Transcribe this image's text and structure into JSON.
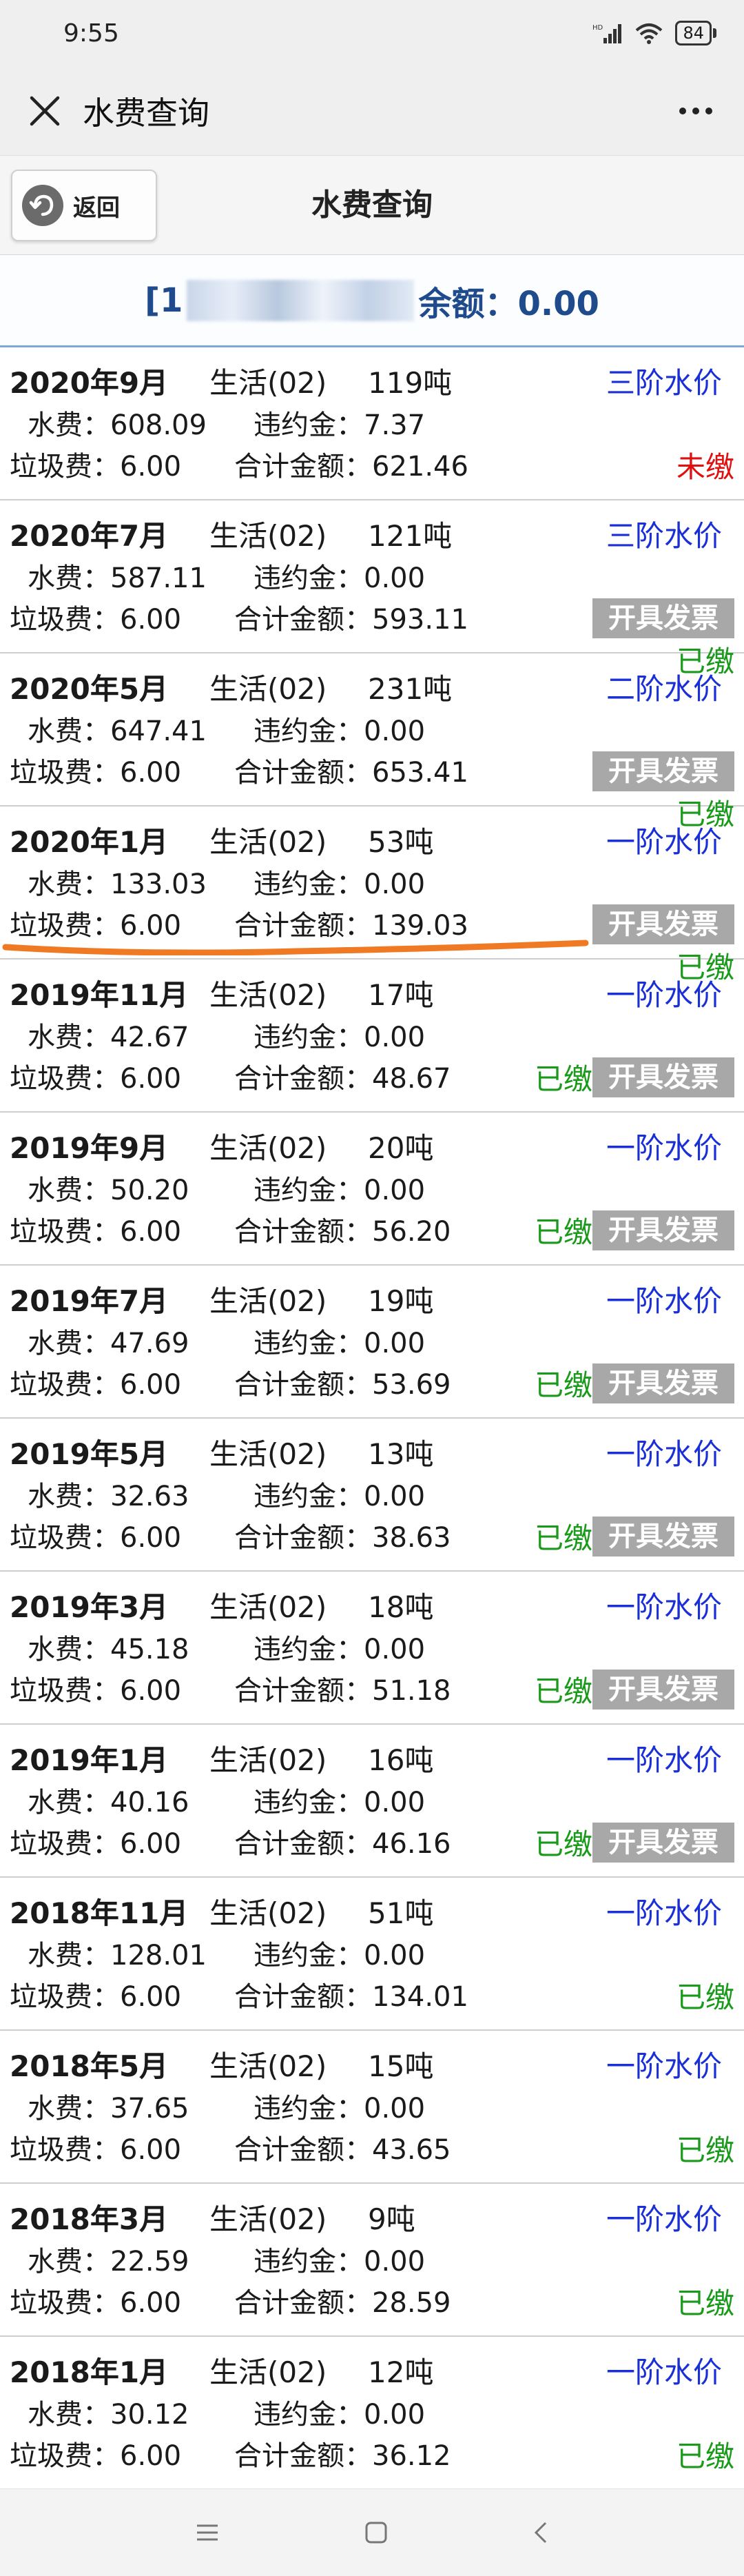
{
  "status_bar": {
    "time": "9:55",
    "battery": "84"
  },
  "title_bar": {
    "title": "水费查询"
  },
  "nav": {
    "back_label": "返回",
    "page_title": "水费查询"
  },
  "account": {
    "prefix": "[1",
    "balance_label": "余额：0.00"
  },
  "records": [
    {
      "year_month": "2020年9月",
      "usage": "生活(02)",
      "tons": "119吨",
      "tier": "三阶水价",
      "water_fee": "水费：608.09",
      "penalty": "违约金：7.37",
      "garbage_fee": "垃圾费：6.00",
      "total": "合计金额：621.46",
      "status": "未缴",
      "invoice": ""
    },
    {
      "year_month": "2020年7月",
      "usage": "生活(02)",
      "tons": "121吨",
      "tier": "三阶水价",
      "water_fee": "水费：587.11",
      "penalty": "违约金：0.00",
      "garbage_fee": "垃圾费：6.00",
      "total": "合计金额：593.11",
      "status": "已缴",
      "invoice": "开具发票"
    },
    {
      "year_month": "2020年5月",
      "usage": "生活(02)",
      "tons": "231吨",
      "tier": "二阶水价",
      "water_fee": "水费：647.41",
      "penalty": "违约金：0.00",
      "garbage_fee": "垃圾费：6.00",
      "total": "合计金额：653.41",
      "status": "已缴",
      "invoice": "开具发票"
    },
    {
      "year_month": "2020年1月",
      "usage": "生活(02)",
      "tons": "53吨",
      "tier": "一阶水价",
      "water_fee": "水费：133.03",
      "penalty": "违约金：0.00",
      "garbage_fee": "垃圾费：6.00",
      "total": "合计金额：139.03",
      "status": "已缴",
      "invoice": "开具发票"
    },
    {
      "year_month": "2019年11月",
      "usage": "生活(02)",
      "tons": "17吨",
      "tier": "一阶水价",
      "water_fee": "水费：42.67",
      "penalty": "违约金：0.00",
      "garbage_fee": "垃圾费：6.00",
      "total": "合计金额：48.67",
      "status": "已缴",
      "invoice": "开具发票"
    },
    {
      "year_month": "2019年9月",
      "usage": "生活(02)",
      "tons": "20吨",
      "tier": "一阶水价",
      "water_fee": "水费：50.20",
      "penalty": "违约金：0.00",
      "garbage_fee": "垃圾费：6.00",
      "total": "合计金额：56.20",
      "status": "已缴",
      "invoice": "开具发票"
    },
    {
      "year_month": "2019年7月",
      "usage": "生活(02)",
      "tons": "19吨",
      "tier": "一阶水价",
      "water_fee": "水费：47.69",
      "penalty": "违约金：0.00",
      "garbage_fee": "垃圾费：6.00",
      "total": "合计金额：53.69",
      "status": "已缴",
      "invoice": "开具发票"
    },
    {
      "year_month": "2019年5月",
      "usage": "生活(02)",
      "tons": "13吨",
      "tier": "一阶水价",
      "water_fee": "水费：32.63",
      "penalty": "违约金：0.00",
      "garbage_fee": "垃圾费：6.00",
      "total": "合计金额：38.63",
      "status": "已缴",
      "invoice": "开具发票"
    },
    {
      "year_month": "2019年3月",
      "usage": "生活(02)",
      "tons": "18吨",
      "tier": "一阶水价",
      "water_fee": "水费：45.18",
      "penalty": "违约金：0.00",
      "garbage_fee": "垃圾费：6.00",
      "total": "合计金额：51.18",
      "status": "已缴",
      "invoice": "开具发票"
    },
    {
      "year_month": "2019年1月",
      "usage": "生活(02)",
      "tons": "16吨",
      "tier": "一阶水价",
      "water_fee": "水费：40.16",
      "penalty": "违约金：0.00",
      "garbage_fee": "垃圾费：6.00",
      "total": "合计金额：46.16",
      "status": "已缴",
      "invoice": "开具发票"
    },
    {
      "year_month": "2018年11月",
      "usage": "生活(02)",
      "tons": "51吨",
      "tier": "一阶水价",
      "water_fee": "水费：128.01",
      "penalty": "违约金：0.00",
      "garbage_fee": "垃圾费：6.00",
      "total": "合计金额：134.01",
      "status": "已缴",
      "invoice": ""
    },
    {
      "year_month": "2018年5月",
      "usage": "生活(02)",
      "tons": "15吨",
      "tier": "一阶水价",
      "water_fee": "水费：37.65",
      "penalty": "违约金：0.00",
      "garbage_fee": "垃圾费：6.00",
      "total": "合计金额：43.65",
      "status": "已缴",
      "invoice": ""
    },
    {
      "year_month": "2018年3月",
      "usage": "生活(02)",
      "tons": "9吨",
      "tier": "一阶水价",
      "water_fee": "水费：22.59",
      "penalty": "违约金：0.00",
      "garbage_fee": "垃圾费：6.00",
      "total": "合计金额：28.59",
      "status": "已缴",
      "invoice": ""
    },
    {
      "year_month": "2018年1月",
      "usage": "生活(02)",
      "tons": "12吨",
      "tier": "一阶水价",
      "water_fee": "水费：30.12",
      "penalty": "违约金：0.00",
      "garbage_fee": "垃圾费：6.00",
      "total": "合计金额：36.12",
      "status": "已缴",
      "invoice": ""
    }
  ],
  "colors": {
    "tier_text": "#1a2fd6",
    "paid": "#1a9a1a",
    "unpaid": "#e01010",
    "invoice_bg": "#a8a8a8",
    "account_text": "#1f4a8c",
    "annotation": "#f07a24"
  }
}
